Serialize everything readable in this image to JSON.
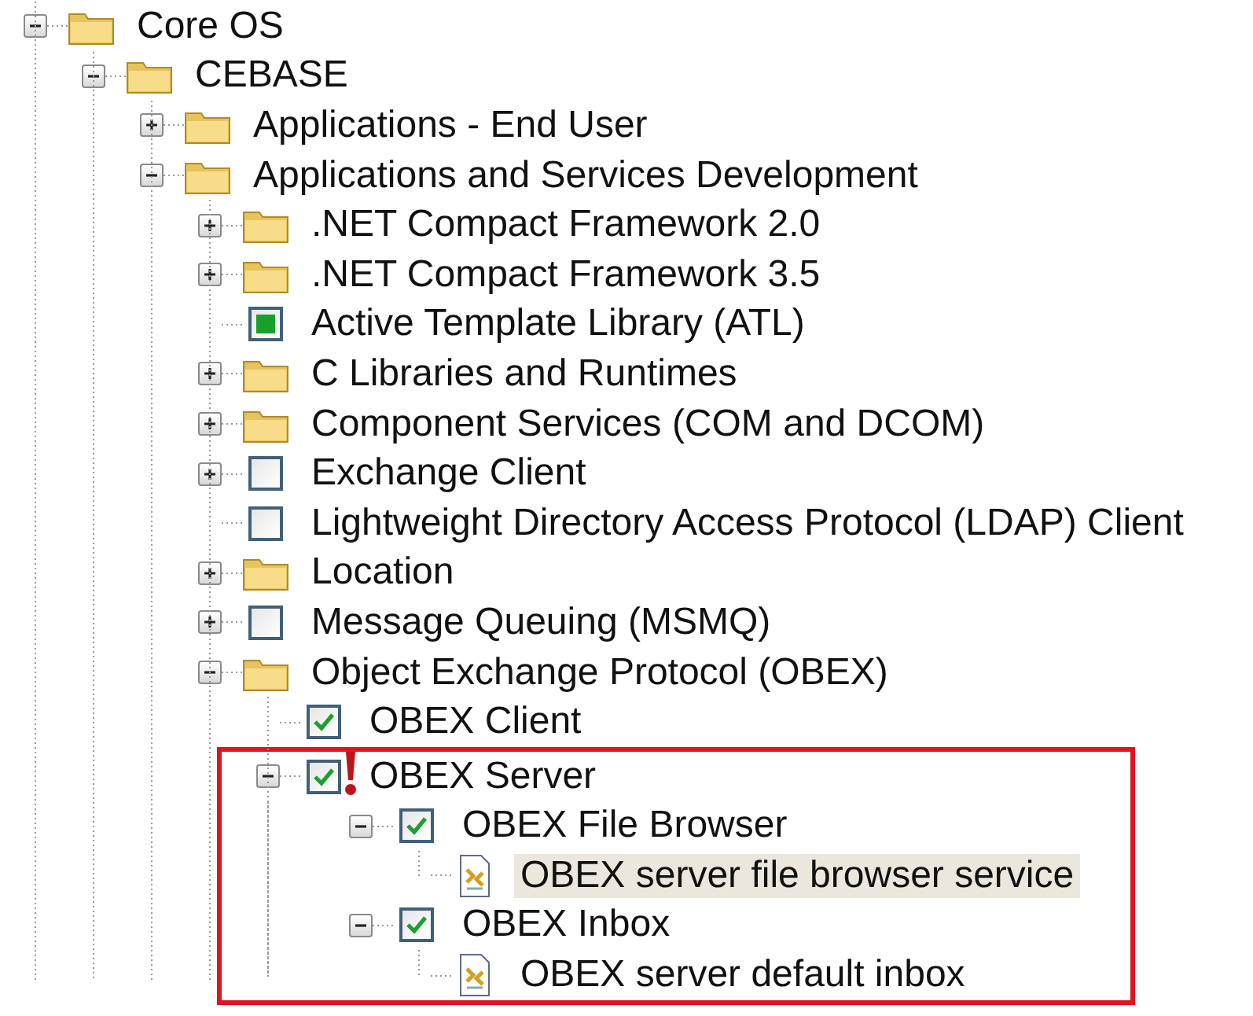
{
  "tree": [
    {
      "label": "Core OS",
      "kind": "folder",
      "expanded": true,
      "selected": false,
      "children": [
        {
          "label": "CEBASE",
          "kind": "folder",
          "expanded": true,
          "selected": false,
          "children": [
            {
              "label": "Applications - End User",
              "kind": "folder",
              "expanded": false,
              "selected": false
            },
            {
              "label": "Applications and Services Development",
              "kind": "folder",
              "expanded": true,
              "selected": false,
              "children": [
                {
                  "label": ".NET Compact Framework 2.0",
                  "kind": "folder",
                  "expanded": false,
                  "selected": false
                },
                {
                  "label": ".NET Compact Framework 3.5",
                  "kind": "folder",
                  "expanded": false,
                  "selected": false
                },
                {
                  "label": "Active Template Library (ATL)",
                  "kind": "checkbox",
                  "checked": false,
                  "partial": true,
                  "selected": false
                },
                {
                  "label": "C Libraries and Runtimes",
                  "kind": "folder",
                  "expanded": false,
                  "selected": false
                },
                {
                  "label": "Component Services (COM and DCOM)",
                  "kind": "folder",
                  "expanded": false,
                  "selected": false
                },
                {
                  "label": "Exchange Client",
                  "kind": "checkbox",
                  "checked": false,
                  "partial": false,
                  "expanded": false,
                  "selected": false
                },
                {
                  "label": "Lightweight Directory Access Protocol (LDAP) Client",
                  "kind": "checkbox",
                  "checked": false,
                  "partial": false,
                  "selected": false
                },
                {
                  "label": "Location",
                  "kind": "folder",
                  "expanded": false,
                  "selected": false
                },
                {
                  "label": "Message Queuing (MSMQ)",
                  "kind": "checkbox",
                  "checked": false,
                  "partial": false,
                  "expanded": false,
                  "selected": false
                },
                {
                  "label": "Object Exchange Protocol (OBEX)",
                  "kind": "folder",
                  "expanded": true,
                  "selected": false,
                  "children": [
                    {
                      "label": "OBEX Client",
                      "kind": "checkbox",
                      "checked": true,
                      "partial": false,
                      "selected": false
                    },
                    {
                      "label": "OBEX Server",
                      "kind": "checkbox",
                      "checked": true,
                      "partial": false,
                      "warning": true,
                      "framed": true,
                      "expanded": true,
                      "selected": false,
                      "children": [
                        {
                          "label": "OBEX File Browser",
                          "kind": "checkbox",
                          "checked": true,
                          "partial": false,
                          "expanded": true,
                          "selected": false,
                          "children": [
                            {
                              "label": "OBEX server file browser service",
                              "kind": "component",
                              "selected": true
                            }
                          ]
                        },
                        {
                          "label": "OBEX Inbox",
                          "kind": "checkbox",
                          "checked": true,
                          "partial": false,
                          "expanded": true,
                          "selected": false,
                          "children": [
                            {
                              "label": "OBEX server default inbox",
                              "kind": "component",
                              "selected": false
                            }
                          ]
                        }
                      ]
                    }
                  ]
                }
              ]
            }
          ]
        }
      ]
    }
  ]
}
